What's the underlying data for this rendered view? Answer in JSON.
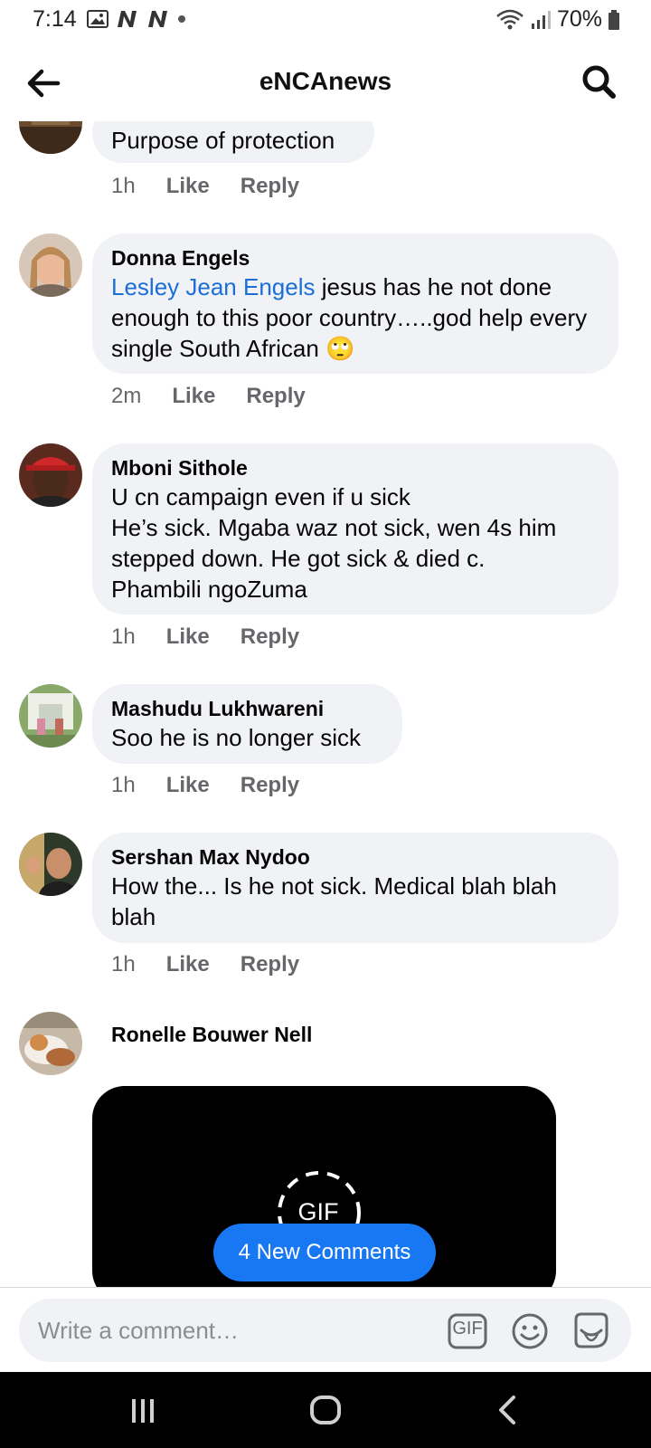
{
  "status_bar": {
    "time": "7:14",
    "battery": "70%"
  },
  "header": {
    "title": "eNCAnews"
  },
  "comments": [
    {
      "text": "Purpose of protection",
      "time": "1h",
      "like": "Like",
      "reply": "Reply"
    },
    {
      "author": "Donna Engels",
      "mention": "Lesley Jean Engels",
      "text": " jesus has he not done enough to this poor country…..god help every single South African 🙄",
      "time": "2m",
      "like": "Like",
      "reply": "Reply"
    },
    {
      "author": "Mboni Sithole",
      "text": "U cn campaign even if u sick\nHe’s sick. Mgaba waz not sick, wen 4s him stepped down. He got sick & died c.\nPhambili ngoZuma",
      "time": "1h",
      "like": "Like",
      "reply": "Reply"
    },
    {
      "author": "Mashudu Lukhwareni",
      "text": "Soo he is no longer sick",
      "time": "1h",
      "like": "Like",
      "reply": "Reply"
    },
    {
      "author": "Sershan Max Nydoo",
      "text": "How the... Is he not sick. Medical blah blah blah",
      "time": "1h",
      "like": "Like",
      "reply": "Reply"
    },
    {
      "author": "Ronelle Bouwer Nell",
      "gif_label": "GIF"
    }
  ],
  "new_comments_button": "4 New Comments",
  "composer": {
    "placeholder": "Write a comment…",
    "gif_label": "GIF"
  }
}
